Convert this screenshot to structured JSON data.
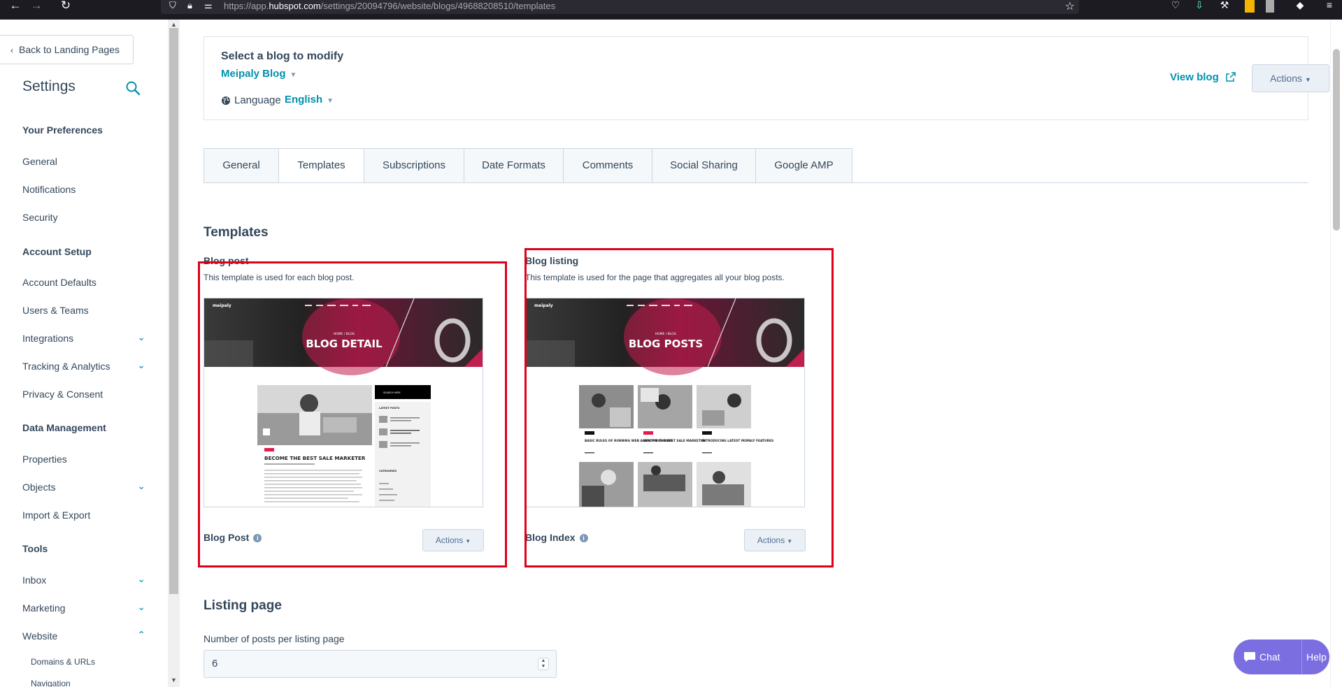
{
  "browser": {
    "url_prefix": "https://app.",
    "url_domain": "hubspot.com",
    "url_path": "/settings/20094796/website/blogs/49688208510/templates"
  },
  "sidebar": {
    "back_label": "Back to Landing Pages",
    "title": "Settings",
    "sections": [
      {
        "label": "Your Preferences"
      },
      {
        "label": "Account Setup"
      },
      {
        "label": "Data Management"
      },
      {
        "label": "Tools"
      }
    ],
    "items": [
      {
        "label": "General"
      },
      {
        "label": "Notifications"
      },
      {
        "label": "Security"
      },
      {
        "label": "Account Defaults"
      },
      {
        "label": "Users & Teams"
      },
      {
        "label": "Integrations"
      },
      {
        "label": "Tracking & Analytics"
      },
      {
        "label": "Privacy & Consent"
      },
      {
        "label": "Properties"
      },
      {
        "label": "Objects"
      },
      {
        "label": "Import & Export"
      },
      {
        "label": "Inbox"
      },
      {
        "label": "Marketing"
      },
      {
        "label": "Website"
      }
    ],
    "subitems": [
      {
        "label": "Domains & URLs"
      },
      {
        "label": "Navigation"
      }
    ]
  },
  "blog_select": {
    "heading": "Select a blog to modify",
    "blog_name": "Meipaly Blog",
    "language_label": "Language",
    "language_value": "English",
    "view_blog": "View blog",
    "actions": "Actions"
  },
  "tabs": [
    {
      "label": "General"
    },
    {
      "label": "Templates"
    },
    {
      "label": "Subscriptions"
    },
    {
      "label": "Date Formats"
    },
    {
      "label": "Comments"
    },
    {
      "label": "Social Sharing"
    },
    {
      "label": "Google AMP"
    }
  ],
  "templates": {
    "heading": "Templates",
    "post": {
      "title": "Blog post",
      "desc": "This template is used for each blog post.",
      "name": "Blog Post",
      "actions": "Actions",
      "preview": {
        "logo": "meipaly",
        "crumb": "HOME / BLOG",
        "hero": "BLOG DETAIL",
        "article_title": "BECOME THE BEST SALE MARKETER",
        "sidebar_box": "SEARCH HERE",
        "latest": "LATEST POSTS",
        "categories": "CATEGORIES"
      }
    },
    "listing": {
      "title": "Blog listing",
      "desc": "This template is used for the page that aggregates all your blog posts.",
      "name": "Blog Index",
      "actions": "Actions",
      "preview": {
        "logo": "meipaly",
        "crumb": "HOME / BLOG",
        "hero": "BLOG POSTS",
        "cards": [
          {
            "title": "BASIC RULES OF RUNNING WEB AGENCY BUSINESS"
          },
          {
            "title": "BECOME THE BEST SALE MARKETER"
          },
          {
            "title": "INTRODUCING LATEST MOPALY FEATURES"
          }
        ]
      }
    }
  },
  "listing_page": {
    "heading": "Listing page",
    "field_label": "Number of posts per listing page",
    "field_value": "6"
  },
  "widgets": {
    "chat": "Chat",
    "help": "Help"
  },
  "colors": {
    "accent": "#0091ae",
    "text": "#33475b",
    "highlight": "#e0001a",
    "chat": "#7b6ee0"
  }
}
